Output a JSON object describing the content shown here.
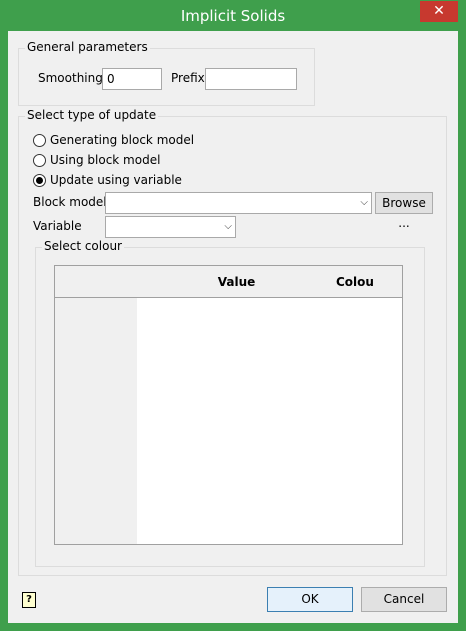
{
  "window": {
    "title": "Implicit Solids",
    "close_glyph": "✕"
  },
  "general": {
    "legend": "General parameters",
    "smoothing_label": "Smoothing",
    "smoothing_value": "0",
    "prefix_label": "Prefix",
    "prefix_value": ""
  },
  "update": {
    "legend": "Select type of update",
    "options": [
      {
        "label": "Generating block model",
        "selected": false
      },
      {
        "label": "Using block model",
        "selected": false
      },
      {
        "label": "Update using variable",
        "selected": true
      }
    ],
    "block_model_label": "Block model",
    "block_model_value": "",
    "browse_label": "Browse ...",
    "variable_label": "Variable",
    "variable_value": ""
  },
  "colour": {
    "legend": "Select colour",
    "columns": [
      "Value",
      "Colour"
    ]
  },
  "footer": {
    "ok_label": "OK",
    "cancel_label": "Cancel",
    "help_glyph": "?"
  },
  "icons": {
    "help": "help-icon",
    "close": "close-icon",
    "dropdown": "chevron-down-icon"
  }
}
